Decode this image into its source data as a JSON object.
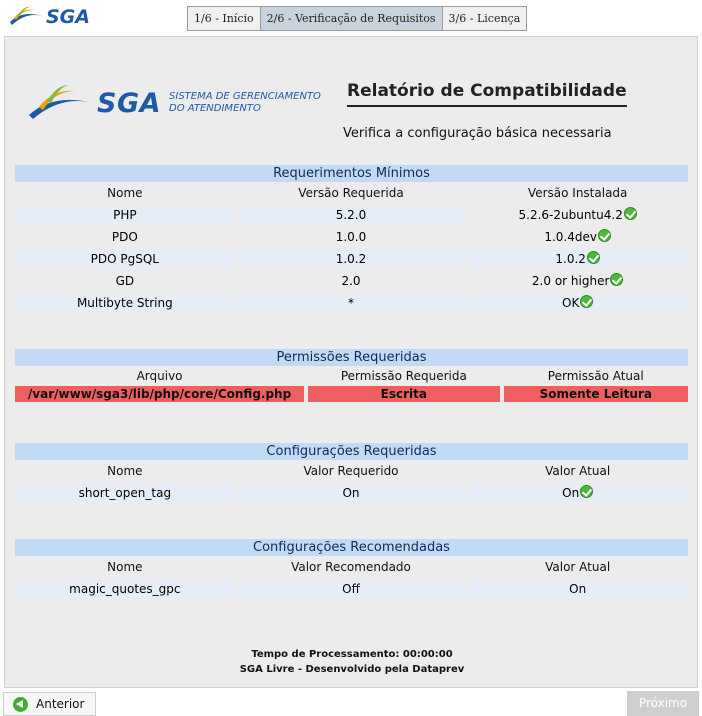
{
  "header": {
    "logo_text": "SGA",
    "tabs": [
      {
        "label": "1/6 - Início"
      },
      {
        "label": "2/6 - Verificação de Requisitos"
      },
      {
        "label": "3/6 - Licença"
      }
    ],
    "active_tab": 1
  },
  "report": {
    "logo_text": "SGA",
    "logo_subtitle_1": "SISTEMA DE GERENCIAMENTO",
    "logo_subtitle_2": "DO ATENDIMENTO",
    "title": "Relatório de Compatibilidade",
    "subtitle": "Verifica a configuração básica necessaria"
  },
  "requirements": {
    "title": "Requerimentos Mínimos",
    "columns": [
      "Nome",
      "Versão Requerida",
      "Versão Instalada"
    ],
    "rows": [
      {
        "name": "PHP",
        "required": "5.2.0",
        "installed": "5.2.6-2ubuntu4.2",
        "status": "ok"
      },
      {
        "name": "PDO",
        "required": "1.0.0",
        "installed": "1.0.4dev",
        "status": "ok"
      },
      {
        "name": "PDO PgSQL",
        "required": "1.0.2",
        "installed": "1.0.2",
        "status": "ok"
      },
      {
        "name": "GD",
        "required": "2.0",
        "installed": "2.0 or higher",
        "status": "ok"
      },
      {
        "name": "Multibyte String",
        "required": "*",
        "installed": "OK",
        "status": "ok"
      }
    ]
  },
  "permissions": {
    "title": "Permissões Requeridas",
    "columns": [
      "Arquivo",
      "Permissão Requerida",
      "Permissão Atual"
    ],
    "rows": [
      {
        "file": "/var/www/sga3/lib/php/core/Config.php",
        "required": "Escrita",
        "current": "Somente Leitura",
        "status": "error"
      }
    ]
  },
  "required_settings": {
    "title": "Configurações Requeridas",
    "columns": [
      "Nome",
      "Valor Requerido",
      "Valor Atual"
    ],
    "rows": [
      {
        "name": "short_open_tag",
        "required": "On",
        "current": "On",
        "status": "ok"
      }
    ]
  },
  "recommended_settings": {
    "title": "Configurações Recomendadas",
    "columns": [
      "Nome",
      "Valor Recomendado",
      "Valor Atual"
    ],
    "rows": [
      {
        "name": "magic_quotes_gpc",
        "recommended": "Off",
        "current": "On"
      }
    ]
  },
  "footer": {
    "processing_time": "Tempo de Processamento: 00:00:00",
    "credits": "SGA Livre - Desenvolvido pela Dataprev"
  },
  "navigation": {
    "prev_label": "Anterior",
    "next_label": "Próximo"
  },
  "colors": {
    "section_header": "#c3daf5",
    "error_row": "#ef5f5f",
    "ok_icon": "#4db83a",
    "brand_blue": "#1f5aa6"
  }
}
